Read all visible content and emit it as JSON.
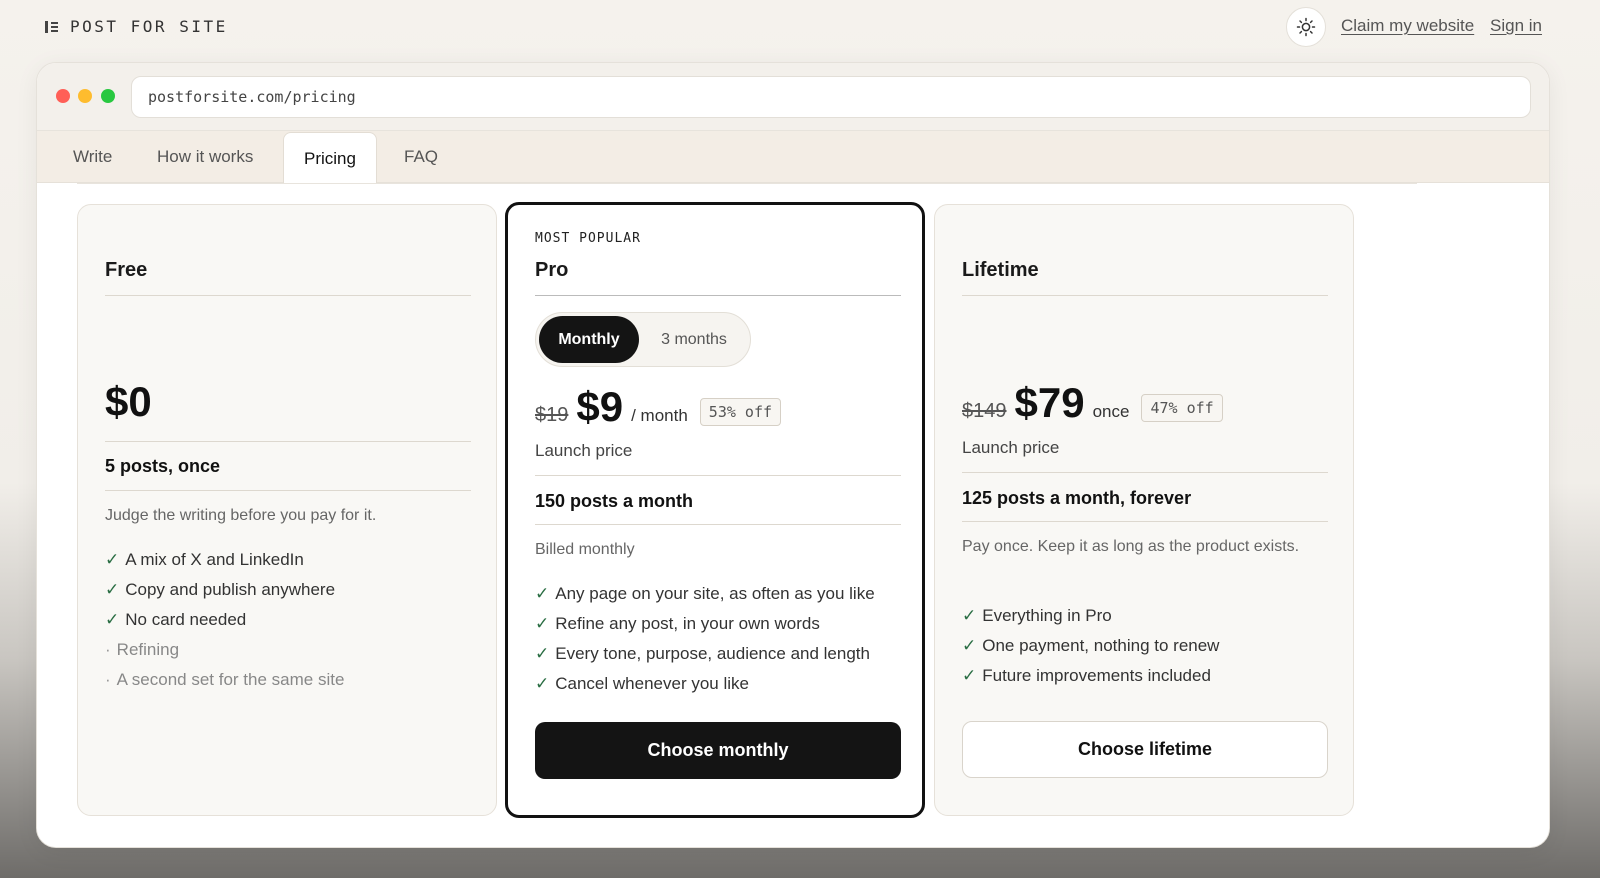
{
  "topbar": {
    "brand": "POST FOR SITE",
    "brand_icon": "logo-bars-icon",
    "theme_icon": "sun-icon",
    "claim_link": "Claim my website",
    "signin_link": "Sign in"
  },
  "browser": {
    "url": "postforsite.com/pricing",
    "tabs": [
      {
        "label": "Write",
        "active": false
      },
      {
        "label": "How it works",
        "active": false
      },
      {
        "label": "Pricing",
        "active": true
      },
      {
        "label": "FAQ",
        "active": false
      }
    ]
  },
  "plans": {
    "free": {
      "name": "Free",
      "price": "$0",
      "quota": "5 posts, once",
      "description": "Judge the writing before you pay for it.",
      "features": [
        {
          "text": "A mix of X and LinkedIn",
          "included": true
        },
        {
          "text": "Copy and publish anywhere",
          "included": true
        },
        {
          "text": "No card needed",
          "included": true
        },
        {
          "text": "Refining",
          "included": false
        },
        {
          "text": "A second set for the same site",
          "included": false
        }
      ]
    },
    "pro": {
      "eyebrow": "MOST POPULAR",
      "name": "Pro",
      "toggle_monthly": "Monthly",
      "toggle_3months": "3 months",
      "selected_period": "Monthly",
      "old_price": "$19",
      "price": "$9",
      "unit": "/ month",
      "badge": "53% off",
      "sub": "Launch price",
      "quota": "150 posts a month",
      "description": "Billed monthly",
      "features": [
        {
          "text": "Any page on your site, as often as you like",
          "included": true
        },
        {
          "text": "Refine any post, in your own words",
          "included": true
        },
        {
          "text": "Every tone, purpose, audience and length",
          "included": true
        },
        {
          "text": "Cancel whenever you like",
          "included": true
        }
      ],
      "cta": "Choose monthly"
    },
    "lifetime": {
      "name": "Lifetime",
      "old_price": "$149",
      "price": "$79",
      "unit": "once",
      "badge": "47% off",
      "sub": "Launch price",
      "quota": "125 posts a month, forever",
      "description": "Pay once. Keep it as long as the product exists.",
      "features": [
        {
          "text": "Everything in Pro",
          "included": true
        },
        {
          "text": "One payment, nothing to renew",
          "included": true
        },
        {
          "text": "Future improvements included",
          "included": true
        }
      ],
      "cta": "Choose lifetime"
    }
  },
  "colors": {
    "accent_dark": "#141414",
    "check_green": "#2b6e44",
    "card_bg": "#f9f8f5"
  }
}
